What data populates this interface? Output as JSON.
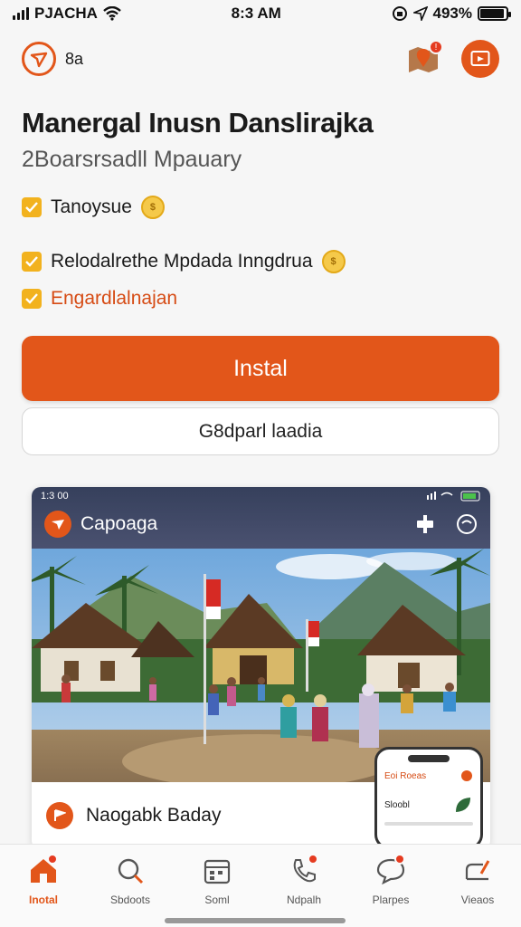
{
  "status_bar": {
    "carrier": "PJACHA",
    "time": "8:3 AM",
    "battery": "493%"
  },
  "header": {
    "brand_name": "8a"
  },
  "title": "Manergal Inusn Danslirajka",
  "subtitle": "2Boarsrsadll Mpauary",
  "features": [
    {
      "label": "Tanoysue"
    },
    {
      "label": "Relodalrethe Mpdada Inngdrua"
    },
    {
      "label": "Engardlalnajan"
    }
  ],
  "install_label": "Instal",
  "secondary_label": "G8dparl laadia",
  "preview": {
    "status_time": "1:3 00",
    "app_name": "Capoaga",
    "bottom_label": "Naogabk Baday",
    "phone_header": "Eoi Roeas",
    "phone_item": "Sloobl"
  },
  "nav": [
    {
      "label": "Inotal",
      "icon": "home-icon",
      "active": true
    },
    {
      "label": "Sbdoots",
      "icon": "search-icon",
      "active": false
    },
    {
      "label": "Soml",
      "icon": "calendar-icon",
      "active": false
    },
    {
      "label": "Ndpalh",
      "icon": "phone-icon",
      "active": false
    },
    {
      "label": "Plarpes",
      "icon": "chat-icon",
      "active": false
    },
    {
      "label": "Vieaos",
      "icon": "edit-icon",
      "active": false
    }
  ],
  "colors": {
    "accent": "#e2561a",
    "check": "#f2b21e",
    "notification": "#e53b20"
  }
}
